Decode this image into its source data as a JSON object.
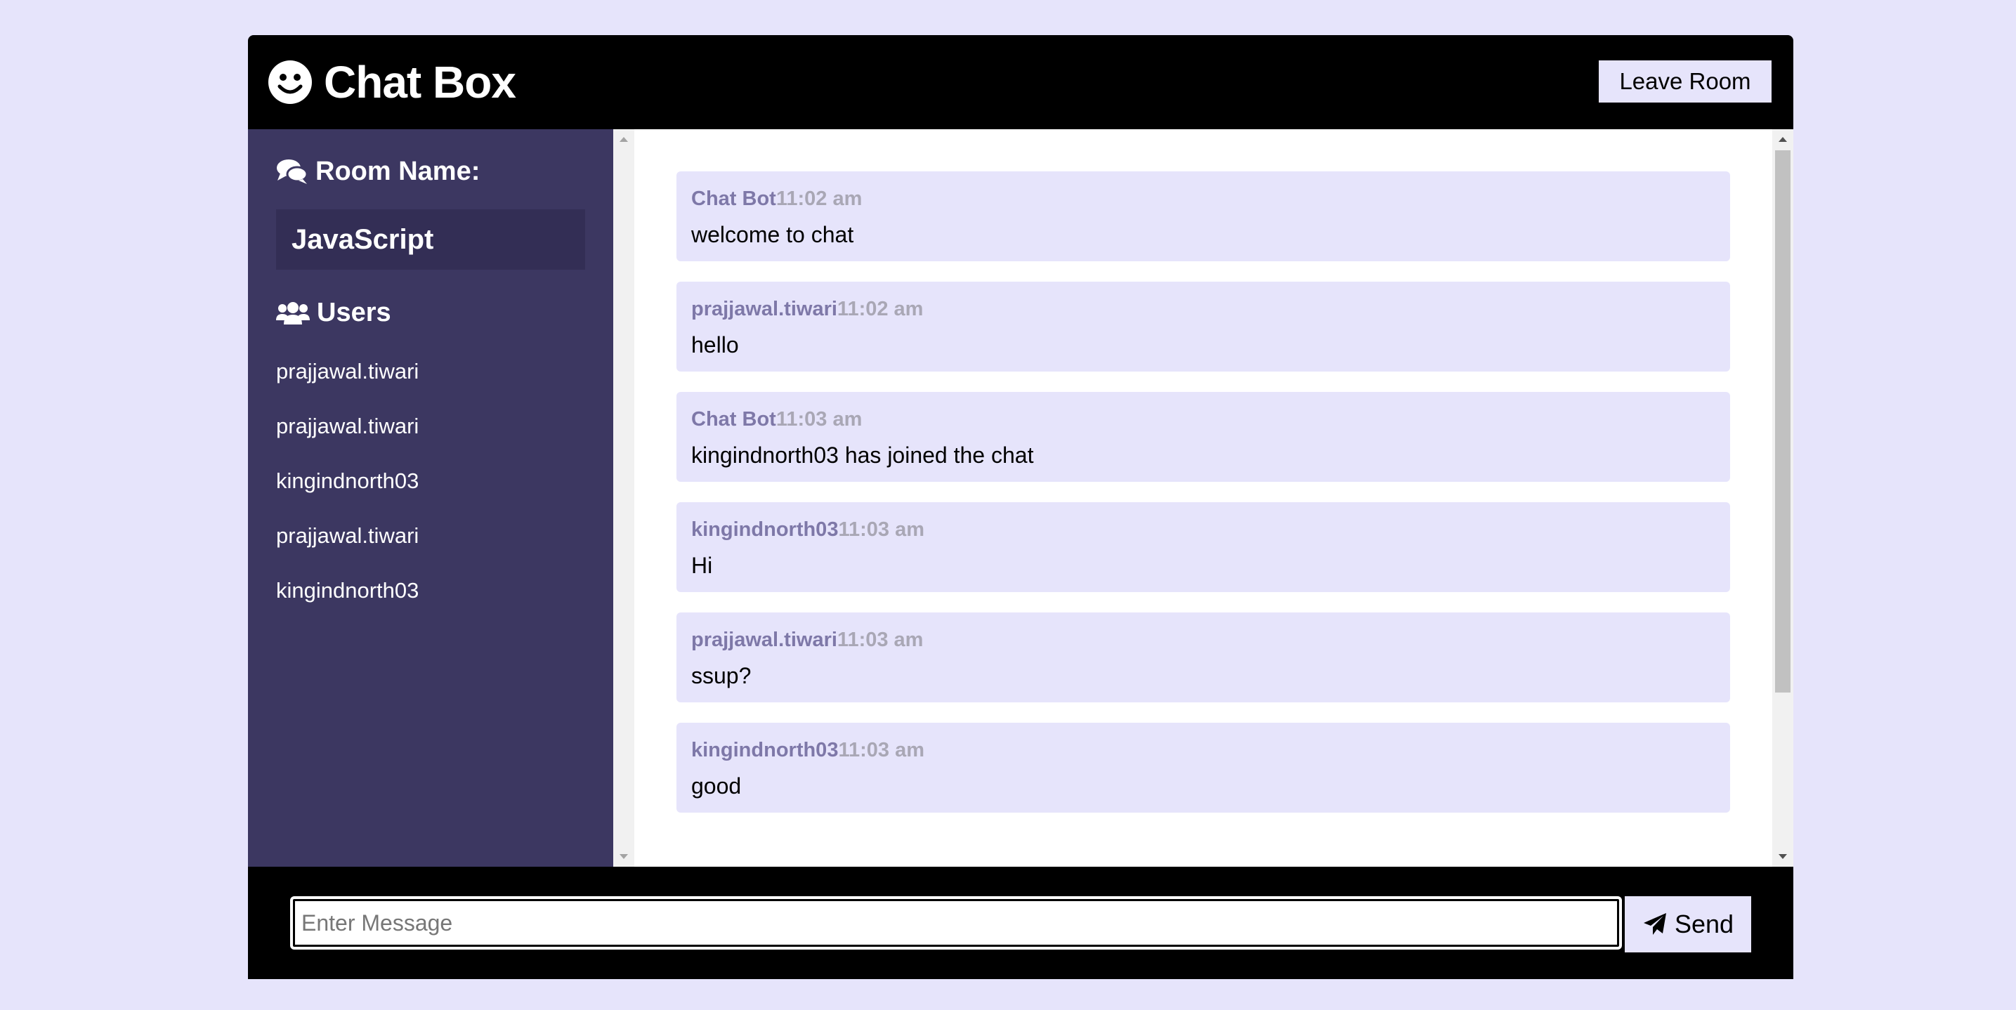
{
  "header": {
    "title": "Chat Box",
    "leave_label": "Leave Room"
  },
  "sidebar": {
    "room_heading": "Room Name:",
    "room_name": "JavaScript",
    "users_heading": "Users",
    "users": [
      "prajjawal.tiwari",
      "prajjawal.tiwari",
      "kingindnorth03",
      "prajjawal.tiwari",
      "kingindnorth03"
    ]
  },
  "messages": [
    {
      "user": "Chat Bot",
      "time": "11:02 am",
      "text": "welcome to chat"
    },
    {
      "user": "prajjawal.tiwari",
      "time": "11:02 am",
      "text": "hello"
    },
    {
      "user": "Chat Bot",
      "time": "11:03 am",
      "text": "kingindnorth03 has joined the chat"
    },
    {
      "user": "kingindnorth03",
      "time": "11:03 am",
      "text": "Hi"
    },
    {
      "user": "prajjawal.tiwari",
      "time": "11:03 am",
      "text": "ssup?"
    },
    {
      "user": "kingindnorth03",
      "time": "11:03 am",
      "text": "good"
    }
  ],
  "composer": {
    "placeholder": "Enter Message",
    "value": "",
    "send_label": "Send"
  },
  "icons": {
    "title": "smile-icon",
    "room": "comments-icon",
    "users": "users-icon",
    "send": "paper-plane-icon"
  },
  "colors": {
    "page_background": "#e6e4fb",
    "header_background": "#000000",
    "sidebar_background": "#3c3761",
    "room_box_background": "#332e55",
    "message_background": "#e6e4fb",
    "message_author": "#7e78a8",
    "message_time": "#a9a7b5"
  }
}
